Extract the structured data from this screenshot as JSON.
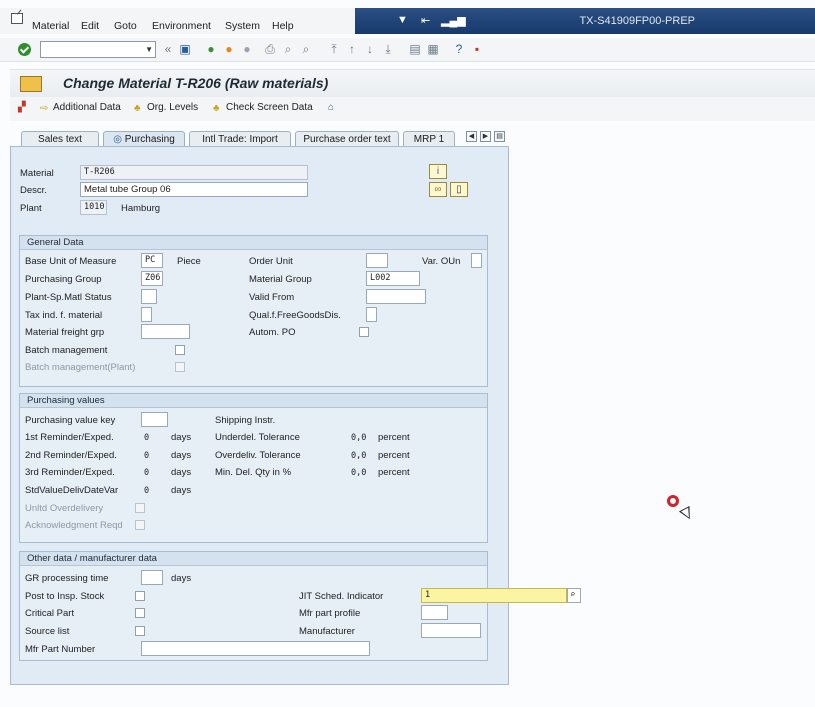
{
  "menubar": {
    "items": [
      "Material",
      "Edit",
      "Goto",
      "Environment",
      "System",
      "Help"
    ],
    "system_id": "TX-S41909FP00-PREP"
  },
  "toolbar": {
    "command_value": ""
  },
  "title": "Change Material T-R206 (Raw materials)",
  "app_toolbar": {
    "additional_data": "Additional Data",
    "org_levels": "Org. Levels",
    "check_screen": "Check Screen Data"
  },
  "tabs": [
    {
      "label": "Sales text"
    },
    {
      "label": "Purchasing"
    },
    {
      "label": "Intl Trade: Import"
    },
    {
      "label": "Purchase order text"
    },
    {
      "label": "MRP 1"
    }
  ],
  "header": {
    "material_label": "Material",
    "material_value": "T-R206",
    "descr_label": "Descr.",
    "descr_value": "Metal tube Group 06",
    "plant_label": "Plant",
    "plant_value": "1010",
    "plant_name": "Hamburg"
  },
  "general": {
    "title": "General Data",
    "base_uom_label": "Base Unit of Measure",
    "base_uom_value": "PC",
    "base_uom_text": "Piece",
    "order_unit_label": "Order Unit",
    "var_oun_label": "Var. OUn",
    "purch_group_label": "Purchasing Group",
    "purch_group_value": "Z06",
    "material_group_label": "Material Group",
    "material_group_value": "L002",
    "plant_status_label": "Plant-Sp.Matl Status",
    "valid_from_label": "Valid From",
    "tax_label": "Tax ind. f. material",
    "qual_label": "Qual.f.FreeGoodsDis.",
    "freight_label": "Material freight grp",
    "autom_po_label": "Autom. PO",
    "batch_label": "Batch management",
    "batch_plant_label": "Batch management(Plant)"
  },
  "purchasing": {
    "title": "Purchasing values",
    "value_key_label": "Purchasing value key",
    "shipping_label": "Shipping Instr.",
    "r1_label": "1st Reminder/Exped.",
    "r1_value": "0",
    "r2_label": "2nd Reminder/Exped.",
    "r2_value": "0",
    "r3_label": "3rd Reminder/Exped.",
    "r3_value": "0",
    "std_label": "StdValueDelivDateVar",
    "std_value": "0",
    "days_unit": "days",
    "underdel_label": "Underdel. Tolerance",
    "underdel_value": "0,0",
    "overdel_label": "Overdeliv. Tolerance",
    "overdel_value": "0,0",
    "mindel_label": "Min. Del. Qty in %",
    "mindel_value": "0,0",
    "percent_unit": "percent",
    "unltd_label": "Unltd Overdelivery",
    "ack_label": "Acknowledgment Reqd"
  },
  "other": {
    "title": "Other data / manufacturer data",
    "gr_label": "GR processing time",
    "gr_unit": "days",
    "post_label": "Post to Insp. Stock",
    "jit_label": "JIT Sched. Indicator",
    "jit_value": "1",
    "critical_label": "Critical Part",
    "mfr_profile_label": "Mfr part profile",
    "source_label": "Source list",
    "manufacturer_label": "Manufacturer",
    "mfr_part_label": "Mfr Part Number"
  }
}
